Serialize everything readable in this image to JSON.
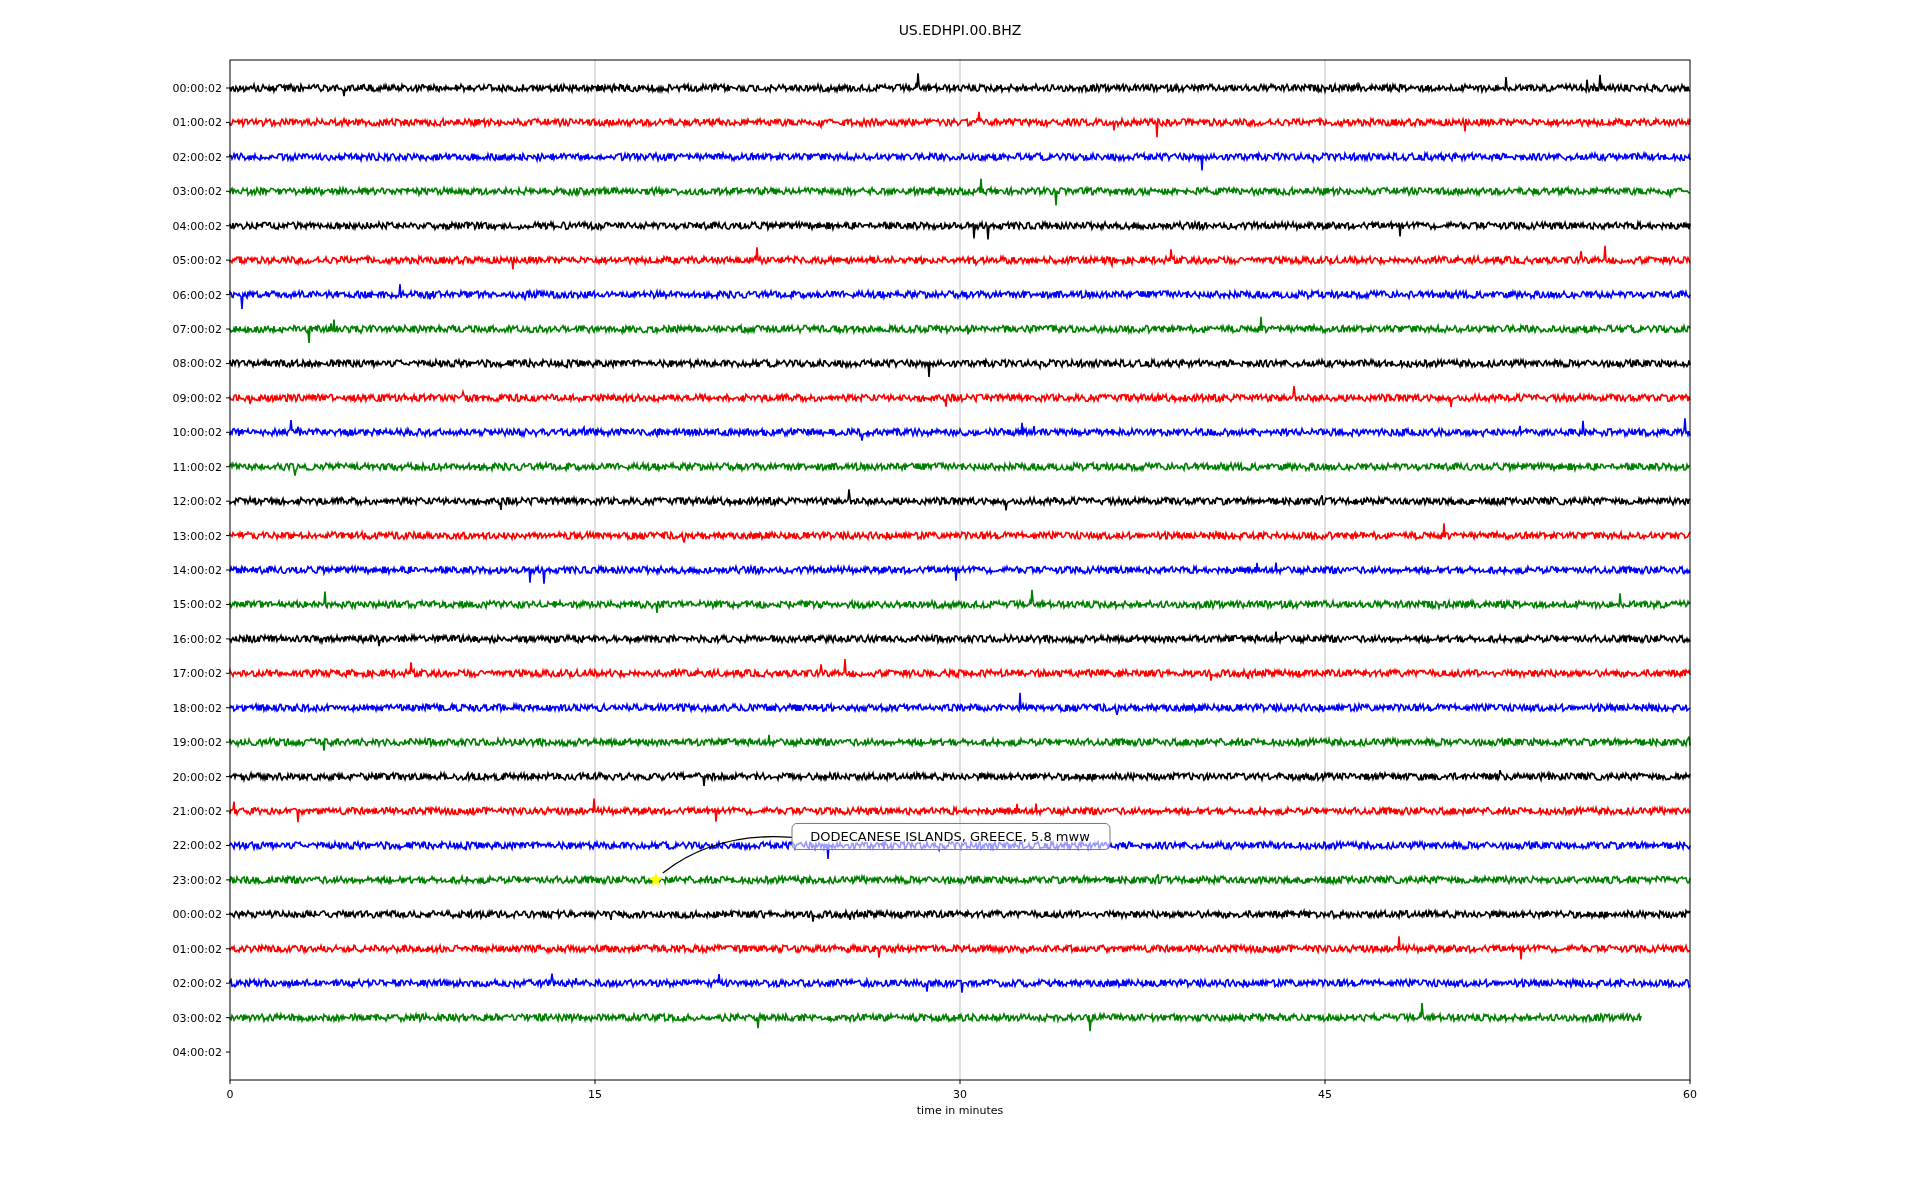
{
  "title": "US.EDHPI.00.BHZ",
  "rows": [
    {
      "label": "00:00:02",
      "color": "#000000"
    },
    {
      "label": "01:00:02",
      "color": "#ff0000"
    },
    {
      "label": "02:00:02",
      "color": "#0000ff"
    },
    {
      "label": "03:00:02",
      "color": "#008000"
    },
    {
      "label": "04:00:02",
      "color": "#000000"
    },
    {
      "label": "05:00:02",
      "color": "#ff0000"
    },
    {
      "label": "06:00:02",
      "color": "#0000ff"
    },
    {
      "label": "07:00:02",
      "color": "#008000"
    },
    {
      "label": "08:00:02",
      "color": "#000000"
    },
    {
      "label": "09:00:02",
      "color": "#ff0000"
    },
    {
      "label": "10:00:02",
      "color": "#0000ff"
    },
    {
      "label": "11:00:02",
      "color": "#008000"
    },
    {
      "label": "12:00:02",
      "color": "#000000"
    },
    {
      "label": "13:00:02",
      "color": "#ff0000"
    },
    {
      "label": "14:00:02",
      "color": "#0000ff"
    },
    {
      "label": "15:00:02",
      "color": "#008000"
    },
    {
      "label": "16:00:02",
      "color": "#000000"
    },
    {
      "label": "17:00:02",
      "color": "#ff0000"
    },
    {
      "label": "18:00:02",
      "color": "#0000ff"
    },
    {
      "label": "19:00:02",
      "color": "#008000"
    },
    {
      "label": "20:00:02",
      "color": "#000000"
    },
    {
      "label": "21:00:02",
      "color": "#ff0000"
    },
    {
      "label": "22:00:02",
      "color": "#0000ff"
    },
    {
      "label": "23:00:02",
      "color": "#008000"
    },
    {
      "label": "00:00:02",
      "color": "#000000"
    },
    {
      "label": "01:00:02",
      "color": "#ff0000"
    },
    {
      "label": "02:00:02",
      "color": "#0000ff"
    },
    {
      "label": "03:00:02",
      "color": "#008000"
    },
    {
      "label": "04:00:02"
    }
  ],
  "x_axis": {
    "label": "time in minutes",
    "ticks": [
      "0",
      "15",
      "30",
      "45",
      "60"
    ]
  },
  "annotation": {
    "text": "DODECANESE ISLANDS, GREECE, 5.8 mww"
  }
}
